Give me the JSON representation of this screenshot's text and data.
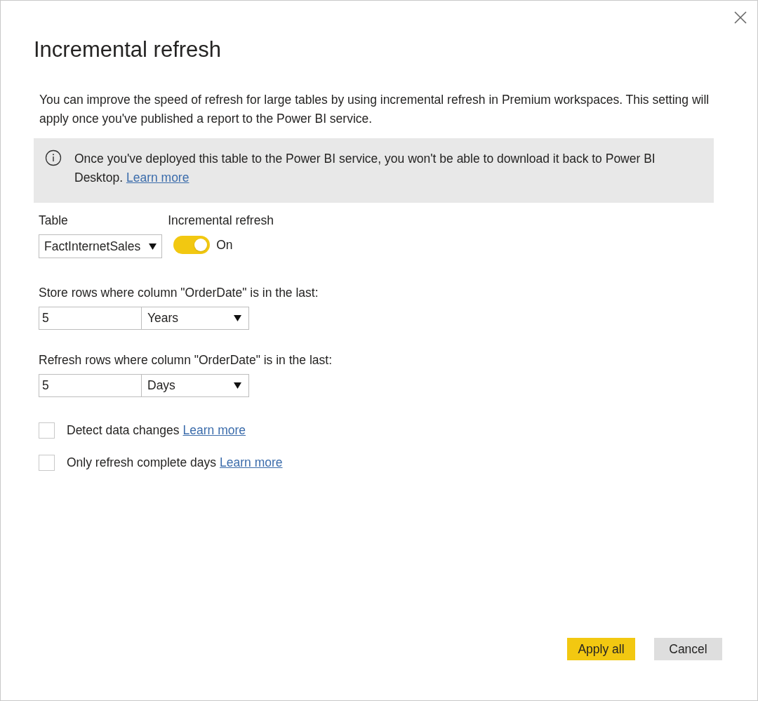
{
  "dialog": {
    "title": "Incremental refresh",
    "description": "You can improve the speed of refresh for large tables by using incremental refresh in Premium workspaces. This setting will apply once you've published a report to the Power BI service."
  },
  "notice": {
    "text": "Once you've deployed this table to the Power BI service, you won't be able to download it back to Power BI Desktop.",
    "link": "Learn more"
  },
  "table": {
    "label": "Table",
    "value": "FactInternetSales"
  },
  "incremental_refresh": {
    "label": "Incremental refresh",
    "on": true,
    "state_text": "On"
  },
  "ranges": [
    {
      "label": "Store rows where column \"OrderDate\" is in the last:",
      "value": "5",
      "unit": "Years"
    },
    {
      "label": "Refresh rows where column \"OrderDate\" is in the last:",
      "value": "5",
      "unit": "Days"
    }
  ],
  "options": [
    {
      "label": "Detect data changes",
      "checked": false,
      "link": "Learn more"
    },
    {
      "label": "Only refresh complete days",
      "checked": false,
      "link": "Learn more"
    }
  ],
  "buttons": [
    {
      "label": "Apply all",
      "kind": "primary"
    },
    {
      "label": "Cancel",
      "kind": "secondary"
    }
  ]
}
